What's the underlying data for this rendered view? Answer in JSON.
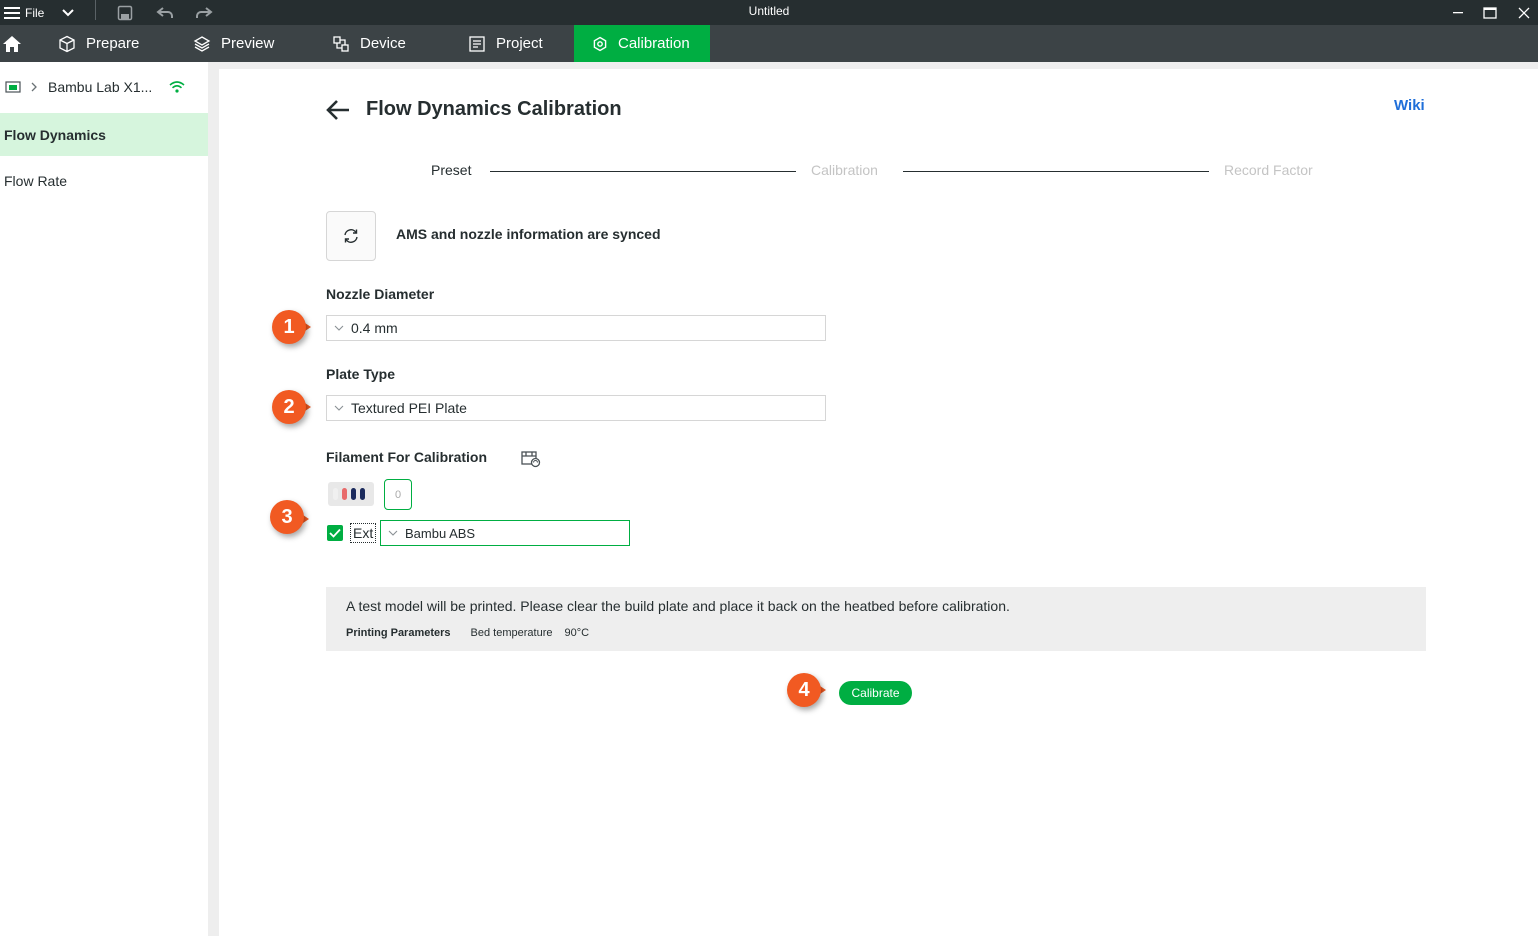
{
  "window": {
    "title": "Untitled",
    "file_menu_label": "File"
  },
  "tabs": [
    {
      "label": "Prepare",
      "icon": "cube-icon"
    },
    {
      "label": "Preview",
      "icon": "layers-icon"
    },
    {
      "label": "Device",
      "icon": "device-icon"
    },
    {
      "label": "Project",
      "icon": "project-icon"
    },
    {
      "label": "Calibration",
      "icon": "calibration-icon",
      "active": true
    }
  ],
  "sidebar": {
    "printer_name": "Bambu Lab X1...",
    "items": [
      {
        "label": "Flow Dynamics",
        "active": true
      },
      {
        "label": "Flow Rate",
        "active": false
      }
    ]
  },
  "main": {
    "title": "Flow Dynamics Calibration",
    "wiki_label": "Wiki",
    "steps": [
      {
        "label": "Preset",
        "state": "current"
      },
      {
        "label": "Calibration",
        "state": "pending"
      },
      {
        "label": "Record Factor",
        "state": "pending"
      }
    ],
    "sync_text": "AMS and nozzle information are synced",
    "nozzle": {
      "label": "Nozzle Diameter",
      "value": "0.4 mm"
    },
    "plate": {
      "label": "Plate Type",
      "value": "Textured PEI Plate"
    },
    "filament": {
      "label": "Filament For Calibration",
      "slot_label": "0",
      "ext_label": "Ext",
      "ext_checked": true,
      "selected": "Bambu ABS"
    },
    "info": {
      "message": "A test model will be printed. Please clear the build plate and place it back on the heatbed before calibration.",
      "params_label": "Printing Parameters",
      "bed_temp_label": "Bed temperature",
      "bed_temp_value": "90°C"
    },
    "calibrate_label": "Calibrate"
  },
  "annotations": [
    "1",
    "2",
    "3",
    "4"
  ],
  "colors": {
    "accent": "#00ae42",
    "badge": "#f15a22",
    "link": "#1f6fd9",
    "titlebar": "#262e30",
    "tabbar": "#3c4346"
  }
}
